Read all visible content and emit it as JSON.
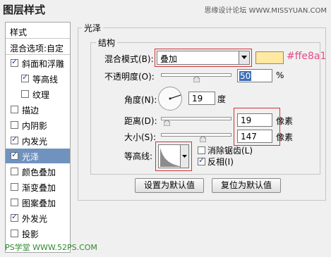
{
  "window": {
    "title": "图层样式"
  },
  "watermark": "思缘设计论坛 WWW.MISSYUAN.COM",
  "left_panel": {
    "items": [
      {
        "label": "样式",
        "has_checkbox": false,
        "checked": false,
        "selected": false
      },
      {
        "label": "混合选项:自定",
        "has_checkbox": false,
        "checked": false,
        "selected": false
      },
      {
        "label": "斜面和浮雕",
        "has_checkbox": true,
        "checked": true,
        "selected": false
      },
      {
        "label": "等高线",
        "has_checkbox": true,
        "checked": true,
        "selected": false
      },
      {
        "label": "纹理",
        "has_checkbox": true,
        "checked": false,
        "selected": false
      },
      {
        "label": "描边",
        "has_checkbox": true,
        "checked": false,
        "selected": false
      },
      {
        "label": "内阴影",
        "has_checkbox": true,
        "checked": false,
        "selected": false
      },
      {
        "label": "内发光",
        "has_checkbox": true,
        "checked": true,
        "selected": false
      },
      {
        "label": "光泽",
        "has_checkbox": true,
        "checked": true,
        "selected": true
      },
      {
        "label": "颜色叠加",
        "has_checkbox": true,
        "checked": false,
        "selected": false
      },
      {
        "label": "渐变叠加",
        "has_checkbox": true,
        "checked": false,
        "selected": false
      },
      {
        "label": "图案叠加",
        "has_checkbox": true,
        "checked": false,
        "selected": false
      },
      {
        "label": "外发光",
        "has_checkbox": true,
        "checked": true,
        "selected": false
      },
      {
        "label": "投影",
        "has_checkbox": true,
        "checked": false,
        "selected": false
      }
    ]
  },
  "satin": {
    "group_title": "光泽",
    "structure_title": "结构",
    "blend_mode": {
      "label": "混合模式(B):",
      "value": "叠加"
    },
    "color": {
      "hex": "#ffe8a1",
      "label": "#ffe8a1"
    },
    "opacity": {
      "label": "不透明度(O):",
      "value": "50",
      "unit": "%",
      "fraction": 0.5
    },
    "angle": {
      "label": "角度(N):",
      "value": "19",
      "unit": "度"
    },
    "distance": {
      "label": "距离(D):",
      "value": "19",
      "unit": "像素",
      "fraction": 0.08
    },
    "size": {
      "label": "大小(S):",
      "value": "147",
      "unit": "像素",
      "fraction": 0.59
    },
    "contour": {
      "label": "等高线:"
    },
    "anti_alias": {
      "label": "消除锯齿(L)",
      "checked": false
    },
    "invert": {
      "label": "反相(I)",
      "checked": true
    }
  },
  "buttons": {
    "make_default": "设置为默认值",
    "reset_default": "复位为默认值"
  },
  "footer_watermark": "PS学堂 WWW.52PS.COM",
  "colors": {
    "selection": "#7092be",
    "highlight_box": "#d43333",
    "check": "#1f3f8f"
  }
}
